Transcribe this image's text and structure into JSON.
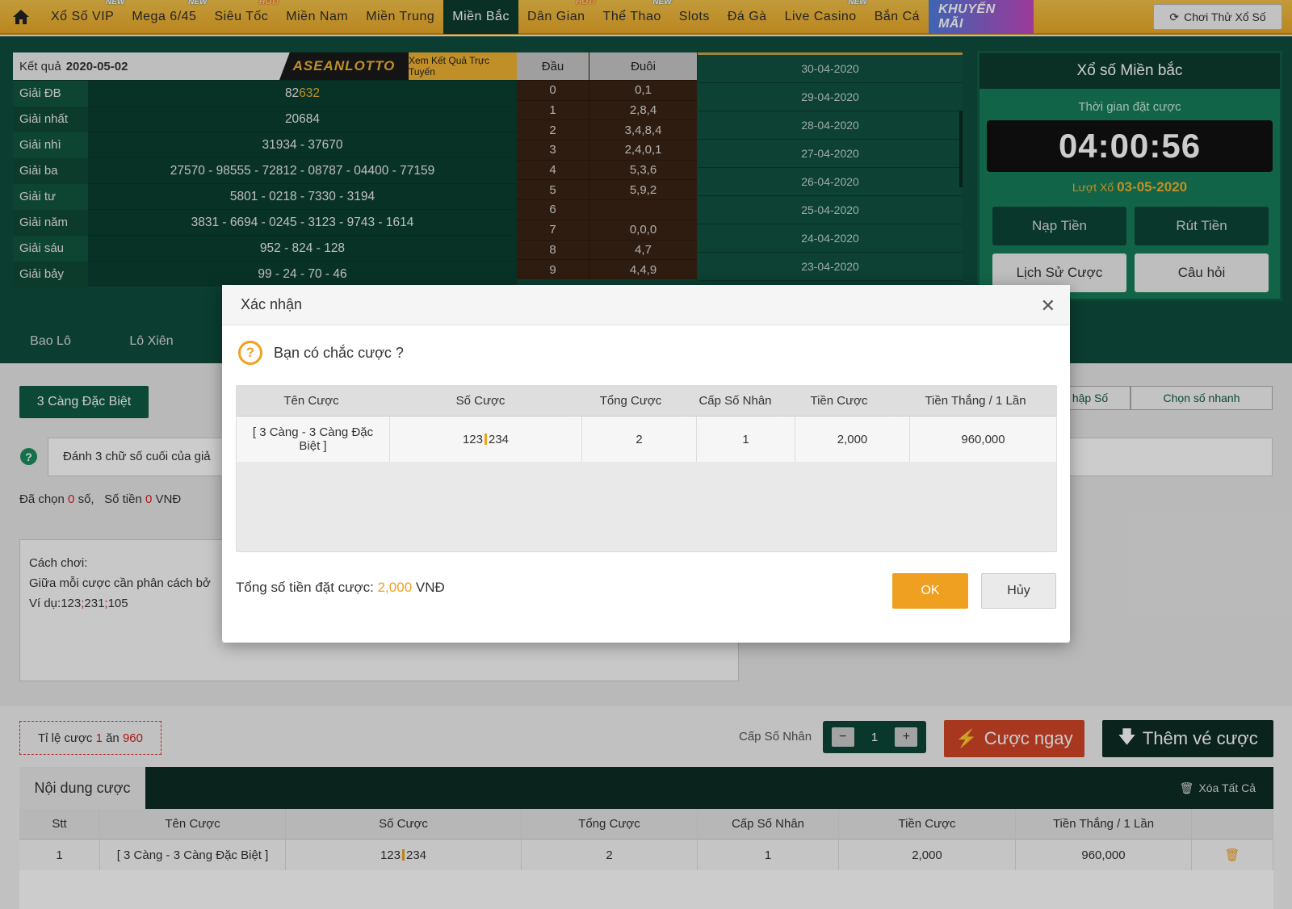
{
  "nav": {
    "items": [
      {
        "label": "Xổ Số VIP",
        "badge": "NEW"
      },
      {
        "label": "Mega 6/45",
        "badge": "NEW"
      },
      {
        "label": "Siêu Tốc",
        "badge": "HOT!"
      },
      {
        "label": "Miền Nam",
        "badge": ""
      },
      {
        "label": "Miền Trung",
        "badge": ""
      },
      {
        "label": "Miền Bắc",
        "badge": ""
      },
      {
        "label": "Dân Gian",
        "badge": "HOT!"
      },
      {
        "label": "Thể Thao",
        "badge": "NEW"
      },
      {
        "label": "Slots",
        "badge": ""
      },
      {
        "label": "Đá Gà",
        "badge": ""
      },
      {
        "label": "Live Casino",
        "badge": "NEW"
      },
      {
        "label": "Bắn Cá",
        "badge": ""
      }
    ],
    "promo": "KHUYẾN MÃI",
    "try": "Chơi Thử Xổ Số"
  },
  "results": {
    "label": "Kết quả",
    "date": "2020-05-02",
    "logo": "ASEANLOTTO",
    "view": "Xem Kết Quả Trực Tuyến",
    "prizes": [
      {
        "name": "Giải ĐB",
        "pre": "82",
        "hl": "632"
      },
      {
        "name": "Giải nhất",
        "pre": "20684",
        "hl": ""
      },
      {
        "name": "Giải nhì",
        "pre": "31934 - 37670",
        "hl": ""
      },
      {
        "name": "Giải ba",
        "pre": "27570 - 98555 - 72812 - 08787 - 04400 - 77159",
        "hl": ""
      },
      {
        "name": "Giải tư",
        "pre": "5801 - 0218 - 7330 - 3194",
        "hl": ""
      },
      {
        "name": "Giải năm",
        "pre": "3831 - 6694 - 0245 - 3123 - 9743 - 1614",
        "hl": ""
      },
      {
        "name": "Giải sáu",
        "pre": "952 - 824 - 128",
        "hl": ""
      },
      {
        "name": "Giải bảy",
        "pre": "99 - 24 - 70 - 46",
        "hl": ""
      }
    ],
    "dd_head": {
      "dau": "Đầu",
      "duoi": "Đuôi"
    },
    "dd": [
      {
        "d": "0",
        "v": "0,1"
      },
      {
        "d": "1",
        "v": "2,8,4"
      },
      {
        "d": "2",
        "v": "3,4,8,4"
      },
      {
        "d": "3",
        "v": "2,4,0,1"
      },
      {
        "d": "4",
        "v": "5,3,6"
      },
      {
        "d": "5",
        "v": "5,9,2"
      },
      {
        "d": "6",
        "v": ""
      },
      {
        "d": "7",
        "v": "0,0,0"
      },
      {
        "d": "8",
        "v": "4,7"
      },
      {
        "d": "9",
        "v": "4,4,9"
      }
    ],
    "dates": [
      "30-04-2020",
      "29-04-2020",
      "28-04-2020",
      "27-04-2020",
      "26-04-2020",
      "25-04-2020",
      "24-04-2020",
      "23-04-2020"
    ]
  },
  "xsmb": {
    "title": "Xổ số Miền bắc",
    "time_label": "Thời gian đặt cược",
    "clock": "04:00:56",
    "draw_label": "Lượt Xổ",
    "draw_date": "03-05-2020",
    "deposit": "Nạp Tiền",
    "withdraw": "Rút Tiền",
    "history": "Lịch Sử Cược",
    "faq": "Câu hỏi"
  },
  "tabs": [
    "Bao Lô",
    "Lô Xiên"
  ],
  "bet": {
    "type_button": "3 Càng Đặc Biệt",
    "subtab1": "hập Số",
    "subtab2": "Chọn số nhanh",
    "desc": "Đánh 3 chữ số cuối của giả",
    "chosen_label": "Đã chọn",
    "chosen_count": "0",
    "chosen_unit": "số,",
    "money_label": "Số tiền",
    "money_value": "0",
    "money_unit": "VNĐ",
    "howto_title": "Cách chơi:",
    "howto_line": "Giữa mỗi cược cần phân cách bở",
    "howto_ex_prefix": "Ví dụ:123",
    "howto_ex_mid": "231",
    "howto_ex_end": "105",
    "howto_sep": ";",
    "ratio_prefix": "Tỉ lệ cược",
    "ratio_a": "1",
    "ratio_mid": "ăn",
    "ratio_b": "960",
    "mult_label": "Cấp Số Nhân",
    "mult_value": "1",
    "minus": "−",
    "plus": "+",
    "bet_now": "Cược ngay",
    "add_ticket": "Thêm vé cược",
    "content_title": "Nội dung cược",
    "clear_all": "Xóa Tất Cả",
    "headers": [
      "Stt",
      "Tên Cược",
      "Số Cược",
      "Tổng Cược",
      "Cấp Số Nhân",
      "Tiền Cược",
      "Tiền Thắng / 1 Lần"
    ],
    "row": {
      "stt": "1",
      "name": "[ 3 Càng - 3 Càng Đặc Biệt ]",
      "num_a": "123",
      "num_b": "234",
      "total": "2",
      "mult": "1",
      "money": "2,000",
      "win": "960,000"
    }
  },
  "modal": {
    "title": "Xác nhận",
    "question": "Bạn có chắc cược ?",
    "headers": [
      "Tên Cược",
      "Số Cược",
      "Tổng Cược",
      "Cấp Số Nhân",
      "Tiền Cược",
      "Tiền Thắng / 1 Lần"
    ],
    "row": {
      "name": "[ 3 Càng - 3 Càng Đặc Biệt ]",
      "num_a": "123",
      "num_b": "234",
      "total": "2",
      "mult": "1",
      "money": "2,000",
      "win": "960,000"
    },
    "total_label": "Tổng số tiền đặt cược:",
    "total_value": "2,000",
    "total_unit": "VNĐ",
    "ok": "OK",
    "cancel": "Hủy"
  },
  "colors": {
    "accent": "#f0a020",
    "dark_green": "#0d3d2f",
    "nav_gold": "#e9a828",
    "danger": "#d34528"
  }
}
